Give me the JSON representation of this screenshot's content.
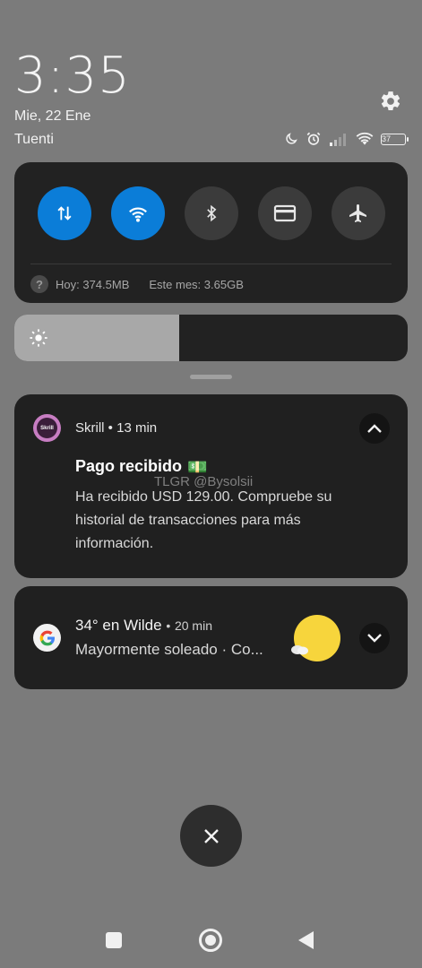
{
  "status": {
    "time": "3:35",
    "date": "Mie, 22 Ene",
    "carrier": "Tuenti",
    "battery": "37",
    "icons": [
      "moon-icon",
      "alarm-icon",
      "signal-icon",
      "wifi-icon",
      "battery-icon"
    ]
  },
  "quick_settings": {
    "tiles": [
      {
        "name": "mobile-data",
        "icon": "data-arrows-icon",
        "active": true
      },
      {
        "name": "wifi",
        "icon": "wifi-icon",
        "active": true
      },
      {
        "name": "bluetooth",
        "icon": "bluetooth-icon",
        "active": false
      },
      {
        "name": "card",
        "icon": "card-icon",
        "active": false
      },
      {
        "name": "airplane",
        "icon": "airplane-icon",
        "active": false
      }
    ],
    "data_today": "Hoy: 374.5MB",
    "data_month": "Este mes: 3.65GB",
    "active_color": "#0b7dd8"
  },
  "brightness": {
    "level": 0.42
  },
  "notifications": {
    "skrill": {
      "app": "Skrill",
      "app_icon_text": "Skrill",
      "separator": "•",
      "time": "13 min",
      "title": "Pago recibido",
      "emoji": "💵",
      "body": "Ha recibido USD 129.00. Compruebe su historial de transacciones para más información."
    },
    "weather": {
      "title": "34° en Wilde",
      "separator": "•",
      "time": "20 min",
      "subtitle": "Mayormente soleado · Co..."
    }
  },
  "watermark": "TLGR @Bysolsii"
}
